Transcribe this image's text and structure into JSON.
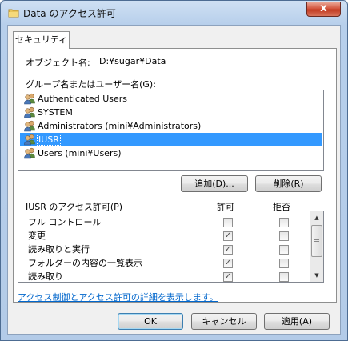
{
  "window": {
    "title": "Data のアクセス許可",
    "close_glyph": "x"
  },
  "tabs": [
    {
      "label": "セキュリティ"
    }
  ],
  "object": {
    "label": "オブジェクト名:",
    "value": "D:¥sugar¥Data"
  },
  "group_label": "グループ名またはユーザー名(G):",
  "users": [
    {
      "name": "Authenticated Users",
      "selected": false
    },
    {
      "name": "SYSTEM",
      "selected": false
    },
    {
      "name": "Administrators (mini¥Administrators)",
      "selected": false
    },
    {
      "name": "IUSR",
      "selected": true
    },
    {
      "name": "Users (mini¥Users)",
      "selected": false
    }
  ],
  "buttons": {
    "add": "追加(D)...",
    "remove": "削除(R)",
    "ok": "OK",
    "cancel": "キャンセル",
    "apply": "適用(A)"
  },
  "permissions": {
    "title": "IUSR のアクセス許可(P)",
    "allow_header": "許可",
    "deny_header": "拒否",
    "check_glyph": "✓",
    "rows": [
      {
        "name": "フル コントロール",
        "allow": false,
        "deny": false
      },
      {
        "name": "変更",
        "allow": true,
        "deny": false
      },
      {
        "name": "読み取りと実行",
        "allow": true,
        "deny": false
      },
      {
        "name": "フォルダーの内容の一覧表示",
        "allow": true,
        "deny": false
      },
      {
        "name": "読み取り",
        "allow": true,
        "deny": false
      }
    ]
  },
  "help_link": "アクセス制御とアクセス許可の詳細を表示します。",
  "icons": {
    "folder": "folder-icon",
    "user": "users-icon",
    "scroll_up": "▲",
    "scroll_down": "▼"
  },
  "colors": {
    "selection": "#3399ff",
    "link": "#0066cc",
    "close_button": "#c23b22"
  }
}
